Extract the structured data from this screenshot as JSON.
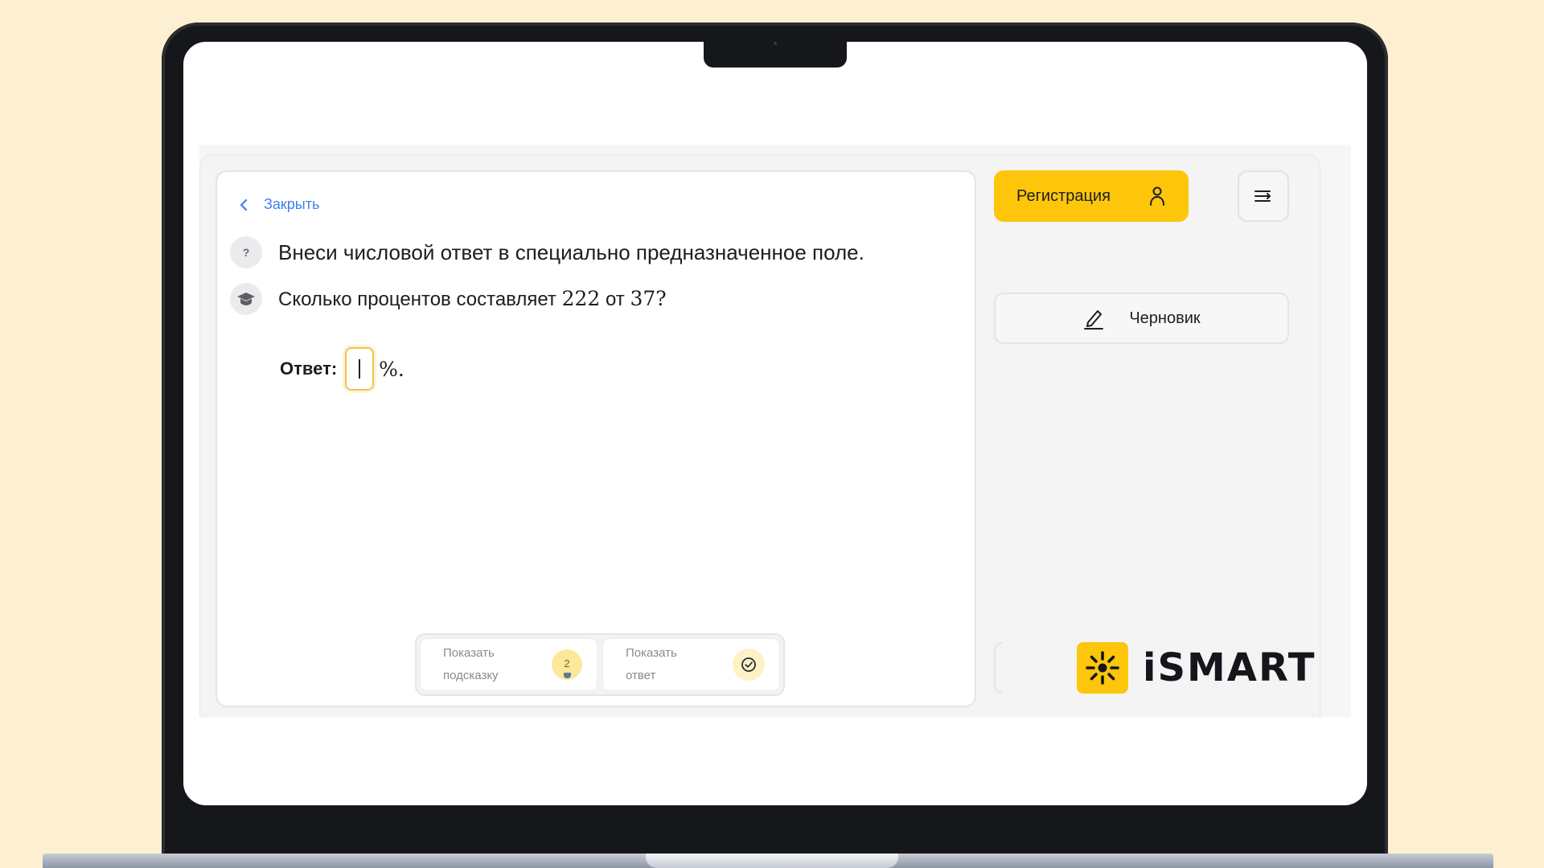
{
  "task": {
    "close_label": "Закрыть",
    "instruction_icon": "?",
    "instruction": "Внеси числовой ответ в специально предназначенное поле.",
    "question_prefix": "Сколько процентов составляет",
    "question_a": "222",
    "question_mid": "от",
    "question_b": "37?",
    "answer_label": "Ответ:",
    "answer_value": "",
    "answer_suffix": "%."
  },
  "hints": {
    "show_hint_line1": "Показать",
    "show_hint_line2": "подсказку",
    "hint_count": "2",
    "show_answer_line1": "Показать",
    "show_answer_line2": "ответ"
  },
  "sidebar": {
    "register_label": "Регистрация",
    "draft_label": "Черновик"
  },
  "brand": {
    "logo_text": "iSMART",
    "accent_color": "#fdc60a",
    "link_color": "#3f7ff0",
    "background_color": "#fdf0d2"
  }
}
